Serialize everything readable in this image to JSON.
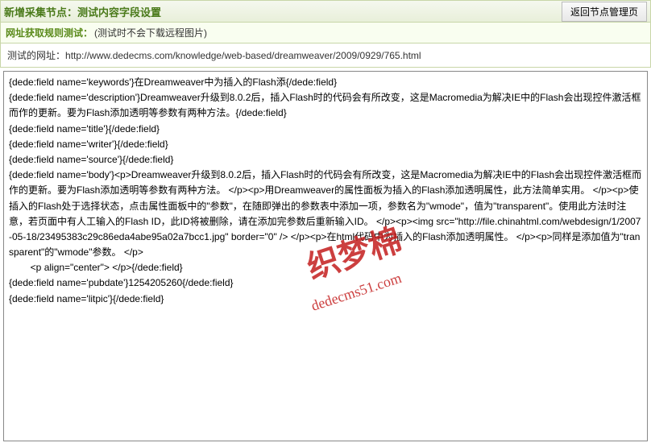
{
  "header": {
    "title": "新增采集节点：测试内容字段设置",
    "return_label": "返回节点管理页"
  },
  "rule_section": {
    "title": "网址获取规则测试：",
    "note": "(测试时不会下载远程图片)"
  },
  "test_url": {
    "label": "测试的网址：",
    "value": "http://www.dedecms.com/knowledge/web-based/dreamweaver/2009/0929/765.html"
  },
  "content": "{dede:field name='keywords'}在Dreamweaver中为插入的Flash添{/dede:field}\n{dede:field name='description'}Dreamweaver升级到8.0.2后，插入Flash时的代码会有所改变，这是Macromedia为解决IE中的Flash会出现控件激活框而作的更新。要为Flash添加透明等参数有两种方法。{/dede:field}\n{dede:field name='title'}{/dede:field}\n{dede:field name='writer'}{/dede:field}\n{dede:field name='source'}{/dede:field}\n{dede:field name='body'}<p>Dreamweaver升级到8.0.2后，插入Flash时的代码会有所改变，这是Macromedia为解决IE中的Flash会出现控件激活框而作的更新。要为Flash添加透明等参数有两种方法。 </p><p>用Dreamweaver的属性面板为插入的Flash添加透明属性，此方法简单实用。 </p><p>使插入的Flash处于选择状态，点击属性面板中的\"参数\"，在随即弹出的参数表中添加一项，参数名为\"wmode\"，值为\"transparent\"。使用此方法时注意，若页面中有人工输入的Flash ID，此ID将被删除，请在添加完参数后重新输入ID。 </p><p><img src=\"http://file.chinahtml.com/webdesign/1/2007-05-18/23495383c29c86eda4abe95a02a7bcc1.jpg\" border=\"0\" /> </p><p>在html代码中为插入的Flash添加透明属性。 </p><p>同样是添加值为\"transparent\"的\"wmode\"参数。 </p>\n        <p align=\"center\"> </p>{/dede:field}\n{dede:field name='pubdate'}1254205260{/dede:field}\n{dede:field name='litpic'}{/dede:field}",
  "watermark": {
    "main": "织梦棉",
    "sub": "dedecms51.com"
  }
}
